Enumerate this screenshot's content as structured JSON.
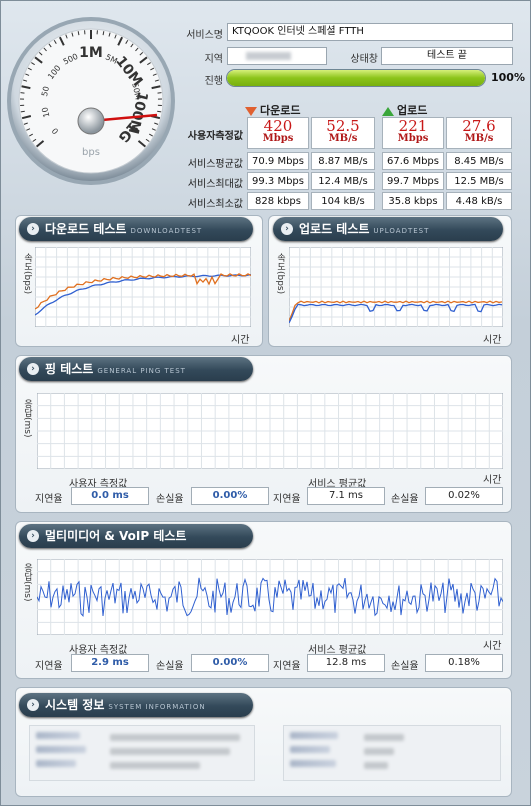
{
  "header": {
    "service_label": "서비스명",
    "service_value": "KTQOOK 인터넷 스페셜 FTTH",
    "region_label": "지역",
    "region_value": "",
    "status_label": "상태창",
    "status_value": "테스트 끝",
    "progress_label": "진행",
    "progress_fraction": 1.0,
    "progress_text": "100%"
  },
  "gauge": {
    "ticks": [
      "0",
      "10",
      "50",
      "100",
      "500",
      "1M",
      "5M",
      "10M",
      "50M",
      "100M",
      "1G"
    ],
    "unit": "bps",
    "needle_value": "1G"
  },
  "results": {
    "download_label": "다운로드",
    "upload_label": "업로드",
    "rows": [
      {
        "label": "사용자측정값",
        "dl_mbps": "420",
        "dl_mbs": "52.5",
        "ul_mbps": "221",
        "ul_mbs": "27.6"
      },
      {
        "label": "서비스평균값",
        "dl_mbps": "70.9 Mbps",
        "dl_mbs": "8.87 MB/s",
        "ul_mbps": "67.6 Mbps",
        "ul_mbs": "8.45 MB/s"
      },
      {
        "label": "서비스최대값",
        "dl_mbps": "99.3 Mbps",
        "dl_mbs": "12.4 MB/s",
        "ul_mbps": "99.7 Mbps",
        "ul_mbs": "12.5 MB/s"
      },
      {
        "label": "서비스최소값",
        "dl_mbps": "828 kbps",
        "dl_mbs": "104 kB/s",
        "ul_mbps": "35.8 kbps",
        "ul_mbs": "4.48 kB/s"
      }
    ],
    "unit_mbps": "Mbps",
    "unit_mbs": "MB/s"
  },
  "download_test": {
    "title": "다운로드 테스트",
    "subtitle": "DOWNLOADTEST",
    "ylabel": "속도(bps)",
    "xlabel": "시간"
  },
  "upload_test": {
    "title": "업로드 테스트",
    "subtitle": "UPLOADTEST",
    "ylabel": "속도(bps)",
    "xlabel": "시간"
  },
  "ping_test": {
    "title": "핑 테스트",
    "subtitle": "GENERAL PING TEST",
    "ylabel": "응답(ms)",
    "xlabel": "시간",
    "user_label": "사용자 측정값",
    "service_label": "서비스 평균값",
    "latency_label": "지연율",
    "loss_label": "손실율",
    "user_latency": "0.0 ms",
    "user_loss": "0.00%",
    "svc_latency": "7.1 ms",
    "svc_loss": "0.02%"
  },
  "multimedia_test": {
    "title": "멀티미디어 & VoIP 테스트",
    "ylabel": "응답(ms)",
    "xlabel": "시간",
    "user_label": "사용자 측정값",
    "service_label": "서비스 평균값",
    "latency_label": "지연율",
    "loss_label": "손실율",
    "user_latency": "2.9 ms",
    "user_loss": "0.00%",
    "svc_latency": "12.8 ms",
    "svc_loss": "0.18%"
  },
  "system_info": {
    "title": "시스템 정보",
    "subtitle": "SYSTEM INFORMATION"
  },
  "colors": {
    "download_series": "#e07020",
    "baseline_series": "#3060d0",
    "accent": "#c81818"
  }
}
